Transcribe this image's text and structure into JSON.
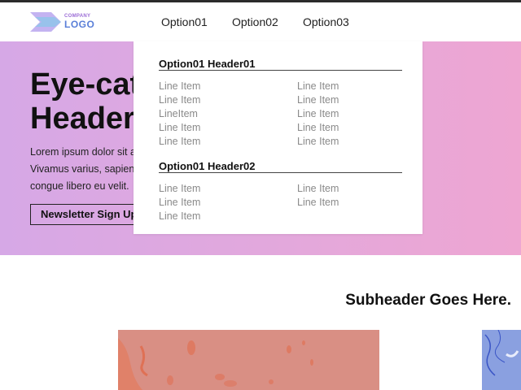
{
  "header": {
    "logo": {
      "small_text": "COMPANY",
      "big_text": "LOGO"
    },
    "nav": [
      "Option01",
      "Option02",
      "Option03"
    ]
  },
  "hero": {
    "title_line1": "Eye-catc",
    "title_line2": "Header",
    "body_lines": [
      "Lorem ipsum dolor sit a",
      "Vivamus varius, sapien",
      "congue libero eu velit."
    ],
    "button_label": "Newsletter Sign Up"
  },
  "dropdown": {
    "groups": [
      {
        "header": "Option01 Header01",
        "left": [
          "Line Item",
          "Line Item",
          "LineItem",
          "Line Item",
          "Line Item"
        ],
        "right": [
          "Line Item",
          "Line Item",
          "Line Item",
          "Line Item",
          "Line Item"
        ]
      },
      {
        "header": "Option01 Header02",
        "left": [
          "Line Item",
          "Line Item",
          "Line Item"
        ],
        "right": [
          "Line Item",
          "Line Item"
        ]
      }
    ]
  },
  "main": {
    "subheader": "Subheader Goes Here."
  },
  "colors": {
    "hero_gradient": [
      "#d6a8e6",
      "#eea6d2"
    ],
    "logo_purple": "#9b6bd6",
    "logo_blue": "#5a7fd8",
    "image_1": "#d98f84",
    "image_2": "#8aa0e0"
  }
}
